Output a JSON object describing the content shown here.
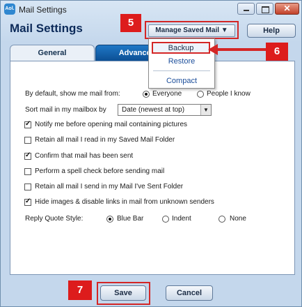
{
  "window": {
    "title": "Mail Settings",
    "logo_text": "Aol."
  },
  "header": {
    "heading": "Mail Settings",
    "manage_saved_mail_label": "Manage Saved Mail",
    "help_label": "Help"
  },
  "tabs": [
    {
      "label": "General",
      "active": true
    },
    {
      "label": "Advanced",
      "active": false
    }
  ],
  "dropdown_menu": {
    "items": [
      "Backup",
      "Restore",
      "Compact"
    ]
  },
  "markers": [
    "5",
    "6",
    "7"
  ],
  "settings": {
    "show_mail_from_label": "By default, show me mail from:",
    "show_mail_from_options": [
      "Everyone",
      "People I know"
    ],
    "show_mail_from_selected": "Everyone",
    "sort_label": "Sort mail in my mailbox by",
    "sort_value": "Date (newest at top)",
    "checkboxes": [
      {
        "label": "Notify me before opening mail containing pictures",
        "checked": true
      },
      {
        "label": "Retain all mail I read in my Saved Mail Folder",
        "checked": false
      },
      {
        "label": "Confirm that mail has been sent",
        "checked": true
      },
      {
        "label": "Perform a spell check before sending mail",
        "checked": false
      },
      {
        "label": "Retain all mail I send in my Mail I've Sent Folder",
        "checked": false
      },
      {
        "label": "Hide images & disable links in mail from unknown senders",
        "checked": true
      }
    ],
    "reply_quote_label": "Reply Quote Style:",
    "reply_quote_options": [
      "Blue Bar",
      "Indent",
      "None"
    ],
    "reply_quote_selected": "Blue Bar"
  },
  "footer": {
    "save_label": "Save",
    "cancel_label": "Cancel"
  },
  "colors": {
    "highlight": "#d42626",
    "marker_bg": "#dd1c1c",
    "heading": "#0d2b5a",
    "advanced_tab": "#1f78c6"
  }
}
